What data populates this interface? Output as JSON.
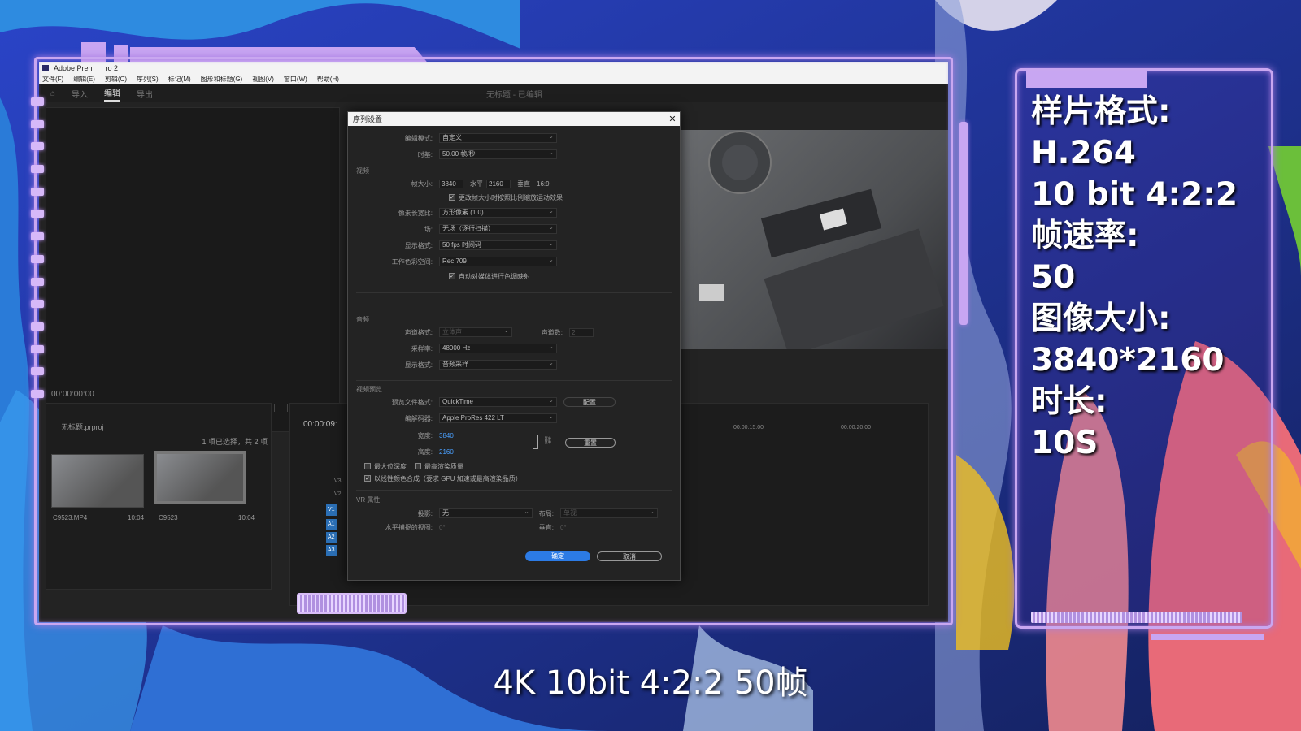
{
  "app": {
    "title": "Adobe Pren",
    "title_suffix": "ro 2",
    "menu": [
      "文件(F)",
      "编辑(E)",
      "剪辑(C)",
      "序列(S)",
      "标记(M)",
      "图形和标题(G)",
      "视图(V)",
      "窗口(W)",
      "帮助(H)"
    ],
    "workspace_tabs": [
      "导入",
      "编辑",
      "导出"
    ],
    "project_title": "无标题 - 已编辑",
    "source_timecode": "00:00:00:00",
    "project_name": "无标题.prproj",
    "selection_status": "1 项已选择，共 2 项",
    "clips": [
      {
        "name": "C9523.MP4",
        "duration": "10:04"
      },
      {
        "name": "C9523",
        "duration": "10:04"
      }
    ],
    "timeline_timecode": "00:00:09:",
    "ruler_marks": [
      "00:00:15:00",
      "00:00:20:00"
    ],
    "tracks": [
      "V3",
      "V2",
      "V1",
      "A1",
      "A2",
      "A3"
    ]
  },
  "dialog": {
    "title": "序列设置",
    "close_icon": "close-icon",
    "editing_mode": {
      "label": "编辑模式:",
      "value": "自定义"
    },
    "timebase": {
      "label": "时基:",
      "value": "50.00 帧/秒"
    },
    "video_section": "视频",
    "frame_size": {
      "label": "帧大小:",
      "width": "3840",
      "h_label": "水平",
      "height": "2160",
      "v_label": "垂直",
      "ratio": "16:9"
    },
    "scale_checkbox": "更改帧大小时按照比例缩放运动效果",
    "pixel_aspect": {
      "label": "像素长宽比:",
      "value": "方形像素 (1.0)"
    },
    "fields": {
      "label": "场:",
      "value": "无场（逐行扫描）"
    },
    "display_format": {
      "label": "显示格式:",
      "value": "50 fps 时间码"
    },
    "color_space": {
      "label": "工作色彩空间:",
      "value": "Rec.709"
    },
    "auto_tone_checkbox": "自动对媒体进行色调映射",
    "audio_section": "音频",
    "channel_format": {
      "label": "声道格式:",
      "value": "立体声",
      "count_label": "声道数:",
      "count": "2"
    },
    "sample_rate": {
      "label": "采样率:",
      "value": "48000 Hz"
    },
    "audio_display": {
      "label": "显示格式:",
      "value": "音频采样"
    },
    "preview_section": "视频预览",
    "preview_format": {
      "label": "预览文件格式:",
      "value": "QuickTime",
      "config": "配置"
    },
    "codec": {
      "label": "编解码器:",
      "value": "Apple ProRes 422 LT"
    },
    "width": {
      "label": "宽度:",
      "value": "3840"
    },
    "height": {
      "label": "高度:",
      "value": "2160"
    },
    "reset_label": "重置",
    "max_depth": "最大位深度",
    "max_quality": "最高渲染质量",
    "linear_color": "以线性颜色合成（要求 GPU 加速或最高渲染品质）",
    "vr_section": "VR 属性",
    "projection": {
      "label": "投影:",
      "value": "无",
      "layout_label": "布局:",
      "layout": "单视"
    },
    "h_view": {
      "label": "水平捕捉的视图:",
      "value": "0°",
      "v_label": "垂直:",
      "v_value": "0°"
    },
    "ok_label": "确定",
    "cancel_label": "取消"
  },
  "info": {
    "lines": [
      "样片格式:",
      "H.264",
      "10 bit 4:2:2",
      "帧速率:",
      "50",
      "图像大小:",
      "3840*2160",
      "时长:",
      "10S"
    ]
  },
  "subtitle": "4K 10bit 4:2:2 50帧",
  "colors": {
    "accent": "#c8a6f2",
    "ok_button": "#2c7be5",
    "background": "#1b2a7a"
  }
}
